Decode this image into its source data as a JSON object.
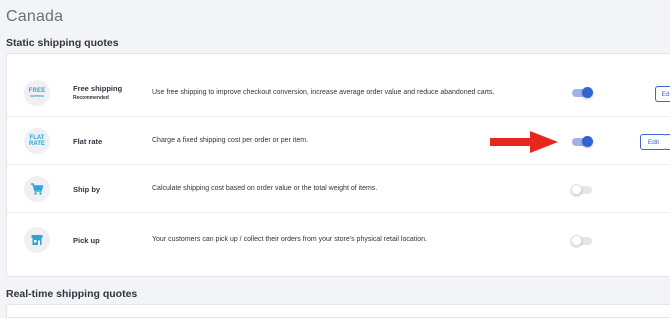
{
  "page": {
    "title": "Canada"
  },
  "sections": {
    "static_title": "Static shipping quotes",
    "realtime_title": "Real-time shipping quotes"
  },
  "methods": [
    {
      "name": "Free shipping",
      "badge": "Recommended",
      "description": "Use free shipping to improve checkout conversion, increase average order value and reduce abandoned carts.",
      "enabled": true,
      "icon": "free-shipping-icon",
      "icon_text": "FREE",
      "icon_subtext": "SHIPPING",
      "edit_label": "Ed"
    },
    {
      "name": "Flat rate",
      "description": "Charge a fixed shipping cost per order or per item.",
      "enabled": true,
      "icon": "flat-rate-icon",
      "icon_text_1": "FLAT",
      "icon_text_2": "RATE",
      "edit_label": "Edit"
    },
    {
      "name": "Ship by",
      "description": "Calculate shipping cost based on order value or the total weight of items.",
      "enabled": false,
      "icon": "cart-icon"
    },
    {
      "name": "Pick up",
      "description": "Your customers can pick up / collect their orders from your store's physical retail location.",
      "enabled": false,
      "icon": "store-icon"
    }
  ],
  "colors": {
    "accent": "#3461d6",
    "icon_blue": "#2ea3d8",
    "arrow_red": "#e8261b"
  }
}
